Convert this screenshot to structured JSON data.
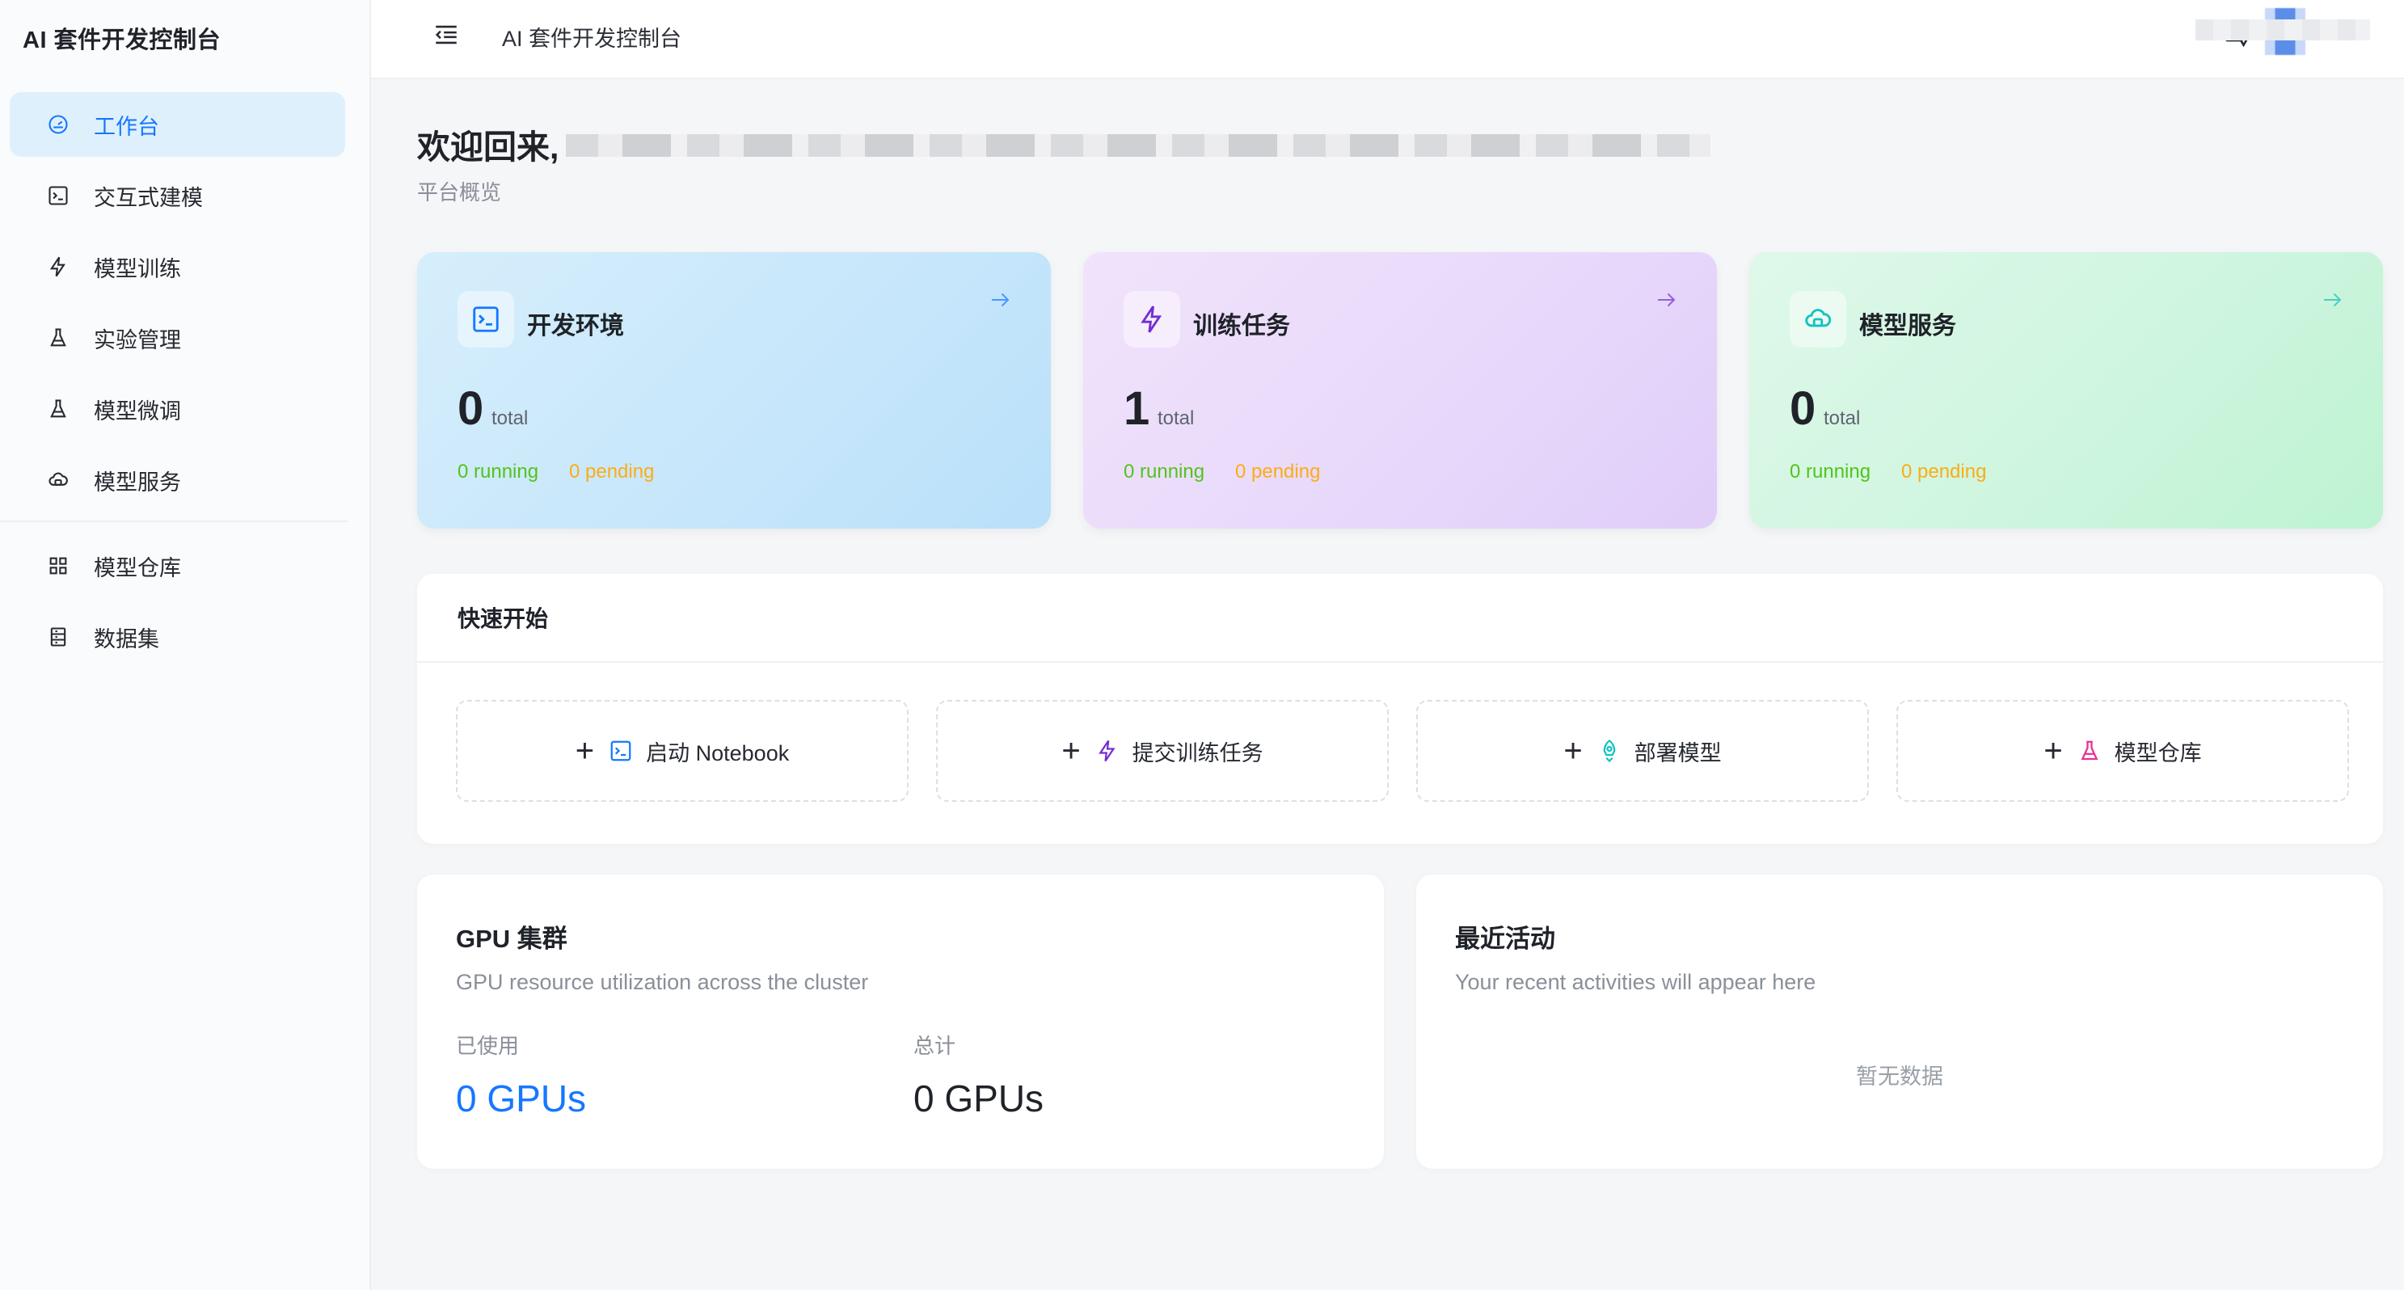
{
  "sidebar": {
    "brand": "AI 套件开发控制台",
    "items": [
      {
        "label": "工作台",
        "icon": "dashboard-icon",
        "active": true
      },
      {
        "label": "交互式建模",
        "icon": "terminal-icon"
      },
      {
        "label": "模型训练",
        "icon": "lightning-icon"
      },
      {
        "label": "实验管理",
        "icon": "flask-icon"
      },
      {
        "label": "模型微调",
        "icon": "flask-icon"
      },
      {
        "label": "模型服务",
        "icon": "cloud-icon"
      }
    ],
    "items2": [
      {
        "label": "模型仓库",
        "icon": "grid-icon"
      },
      {
        "label": "数据集",
        "icon": "database-icon"
      }
    ]
  },
  "header": {
    "title": "AI 套件开发控制台"
  },
  "main": {
    "welcome": "欢迎回来,",
    "subtitle": "平台概览",
    "cards": [
      {
        "title": "开发环境",
        "count": "0",
        "unit": "total",
        "running": "0 running",
        "pending": "0 pending",
        "icon": "terminal-icon",
        "accent": "#1677ff"
      },
      {
        "title": "训练任务",
        "count": "1",
        "unit": "total",
        "running": "0 running",
        "pending": "0 pending",
        "icon": "lightning-icon",
        "accent": "#722ed1"
      },
      {
        "title": "模型服务",
        "count": "0",
        "unit": "total",
        "running": "0 running",
        "pending": "0 pending",
        "icon": "cloud-icon",
        "accent": "#13c2c2"
      }
    ],
    "quick_start": {
      "title": "快速开始",
      "actions": [
        {
          "label": "启动 Notebook",
          "icon": "terminal-icon"
        },
        {
          "label": "提交训练任务",
          "icon": "lightning-icon"
        },
        {
          "label": "部署模型",
          "icon": "rocket-icon"
        },
        {
          "label": "模型仓库",
          "icon": "flask-icon"
        }
      ]
    },
    "gpu": {
      "title": "GPU 集群",
      "desc": "GPU resource utilization across the cluster",
      "used_label": "已使用",
      "total_label": "总计",
      "used_value": "0 GPUs",
      "total_value": "0 GPUs"
    },
    "activity": {
      "title": "最近活动",
      "desc": "Your recent activities will appear here",
      "empty": "暂无数据"
    }
  },
  "colors": {
    "primary": "#1677ff",
    "running": "#52c41a",
    "pending": "#faad14"
  }
}
